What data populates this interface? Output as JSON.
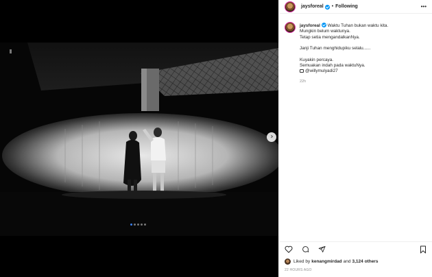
{
  "post": {
    "username": "jaysforeal",
    "follow_label": "Following",
    "separator": "•",
    "more_label": "•••"
  },
  "caption": {
    "username": "jaysforeal",
    "lines": [
      "Waktu Tuhan bukan waktu kita.",
      "Mungkin belum waktunya.",
      "Tetap setia mengandalkanNya.",
      "",
      "Janji Tuhan menghidupiku selalu......",
      "",
      "Kuyakin percaya.",
      "Semuakan indah pada waktuNya."
    ],
    "mention": "@willymulyadi27",
    "time_ago": "22h"
  },
  "carousel": {
    "slide_count": 5,
    "active_index": 0,
    "next_label": "›"
  },
  "likes": {
    "prefix": "Liked by",
    "user": "kenangmirdad",
    "joiner": "and",
    "count": "3,124 others"
  },
  "posted_time": "22 HOURS AGO",
  "icons": {
    "like": "heart-icon",
    "comment": "comment-icon",
    "share": "share-icon",
    "save": "bookmark-icon"
  }
}
